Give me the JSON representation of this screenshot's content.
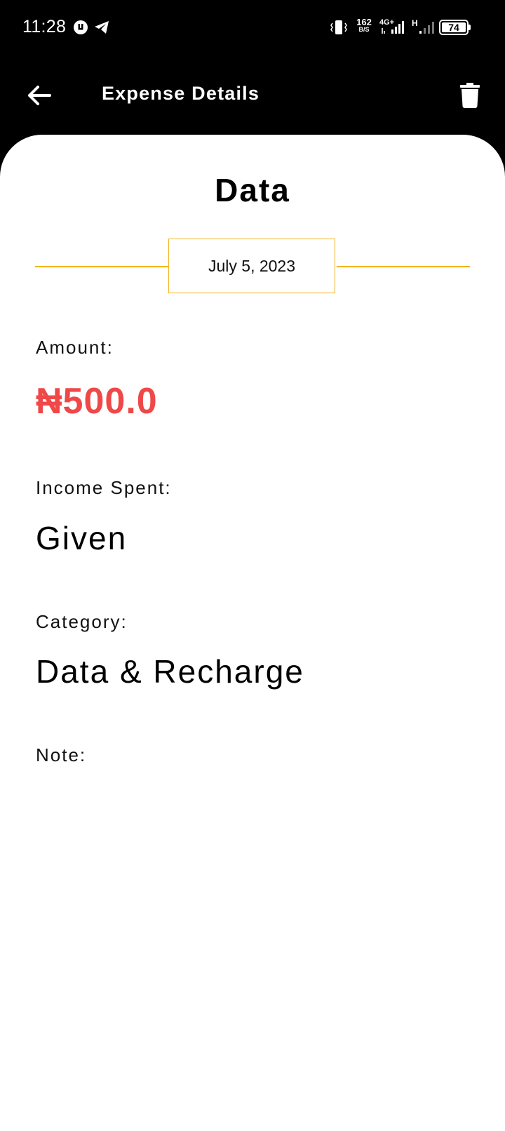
{
  "status_bar": {
    "time": "11:28",
    "net_speed_value": "162",
    "net_speed_unit": "B/S",
    "network_type": "4G+",
    "secondary_network": "H",
    "battery": "74"
  },
  "app_bar": {
    "title": "Expense Details"
  },
  "detail": {
    "title": "Data",
    "date": "July 5, 2023",
    "amount_label": "Amount:",
    "amount_value": "₦500.0",
    "income_label": "Income Spent:",
    "income_value": "Given",
    "category_label": "Category:",
    "category_value": "Data & Recharge",
    "note_label": "Note:",
    "note_value": ""
  },
  "colors": {
    "app_bar_background": "#000000",
    "accent": "#f2b31f",
    "amount": "#ef4848"
  }
}
